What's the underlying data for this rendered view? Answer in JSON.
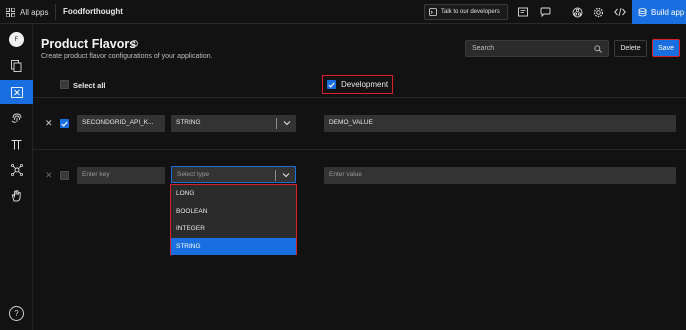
{
  "topbar": {
    "all_apps": "All apps",
    "app_name": "Foodforthought",
    "talk_label": "Talk to our developers",
    "build_label": "Build app"
  },
  "sidebar": {
    "avatar_initial": "F",
    "items": [
      {
        "icon": "files-icon"
      },
      {
        "icon": "variable-icon",
        "active": true
      },
      {
        "icon": "fingerprint-icon"
      },
      {
        "icon": "pi-icon"
      },
      {
        "icon": "network-icon"
      },
      {
        "icon": "hand-icon"
      }
    ],
    "help": "?"
  },
  "page": {
    "title": "Product Flavors",
    "subtitle": "Create product flavor configurations of your application.",
    "search_placeholder": "Search",
    "delete_label": "Delete",
    "save_label": "Save",
    "select_all_label": "Select all",
    "flavor_column": "Development"
  },
  "rows": [
    {
      "checked": true,
      "key": "SECONDGRID_API_K...",
      "type": "STRING",
      "value": "DEMO_VALUE"
    }
  ],
  "new_row": {
    "key_placeholder": "Enter key",
    "type_placeholder": "Select type",
    "value_placeholder": "Enter value"
  },
  "type_options": [
    "LONG",
    "BOOLEAN",
    "INTEGER",
    "STRING"
  ],
  "highlighted_option": "STRING",
  "colors": {
    "accent": "#1a6fe0",
    "highlight_border": "#d6202e",
    "background": "#121212"
  }
}
